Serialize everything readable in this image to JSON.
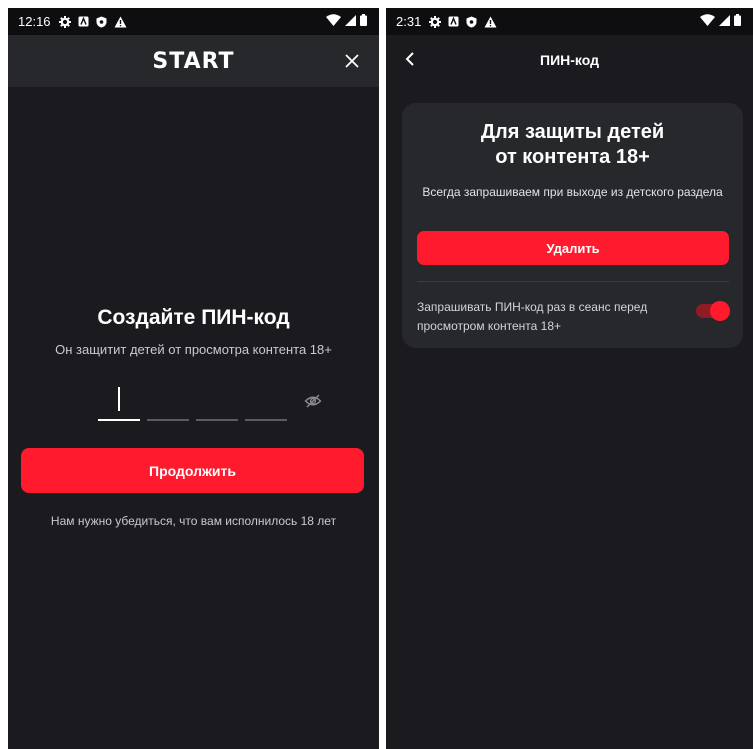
{
  "left": {
    "status": {
      "time": "12:16"
    },
    "header": {
      "logo": "START"
    },
    "title": "Создайте ПИН-код",
    "subtitle": "Он защитит детей от просмотра контента 18+",
    "continue_label": "Продолжить",
    "note": "Нам нужно убедиться, что вам исполнилось 18 лет"
  },
  "right": {
    "status": {
      "time": "2:31"
    },
    "header": {
      "title": "ПИН-код"
    },
    "card": {
      "title_line1": "Для защиты детей",
      "title_line2": "от контента 18+",
      "description": "Всегда запрашиваем при выходе из детского раздела",
      "delete_label": "Удалить",
      "toggle_label": "Запрашивать ПИН-код раз в сеанс перед просмотром контента 18+",
      "toggle_on": true
    }
  },
  "colors": {
    "accent": "#ff1a2e",
    "background": "#1b1b1f",
    "surface": "#26282c"
  },
  "icons": [
    "settings-icon",
    "a-box-icon",
    "shield-icon",
    "warning-icon",
    "wifi-icon",
    "signal-icon",
    "battery-icon",
    "close-icon",
    "eye-off-icon",
    "back-arrow-icon"
  ]
}
